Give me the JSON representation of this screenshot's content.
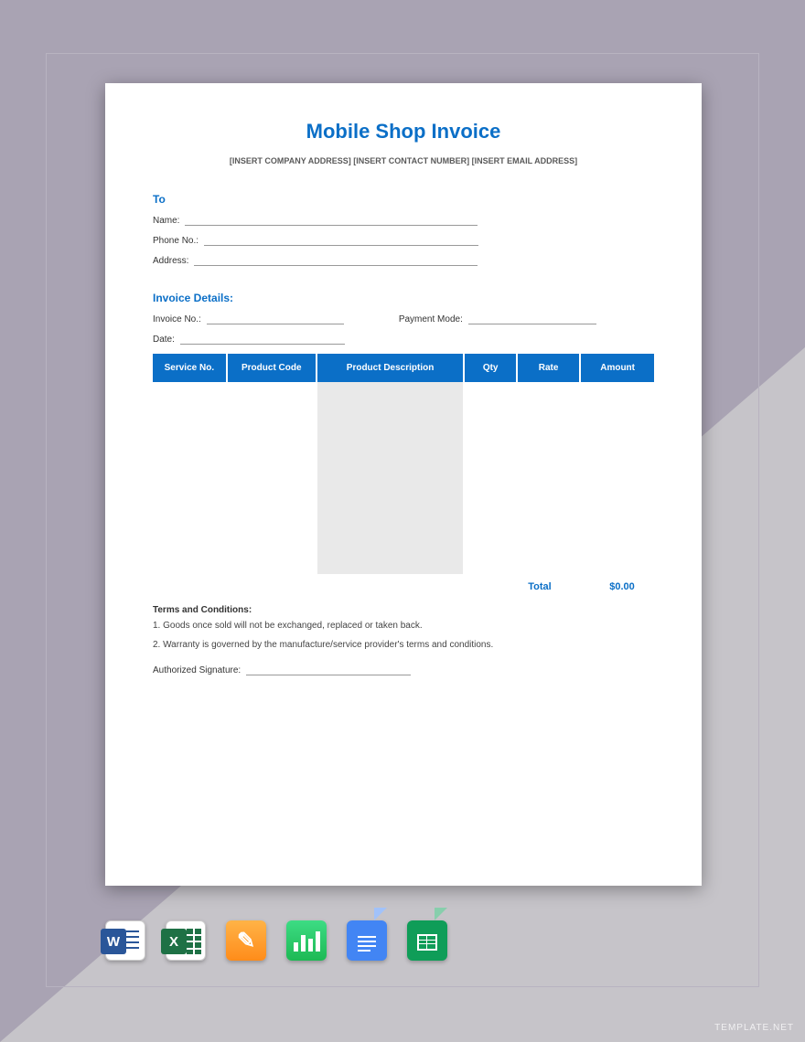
{
  "title": "Mobile Shop Invoice",
  "subtitle": "[INSERT COMPANY ADDRESS] [INSERT CONTACT NUMBER] [INSERT EMAIL ADDRESS]",
  "to": {
    "heading": "To",
    "name_label": "Name:",
    "phone_label": "Phone No.:",
    "address_label": "Address:"
  },
  "details": {
    "heading": "Invoice Details:",
    "invoice_no_label": "Invoice No.:",
    "date_label": "Date:",
    "payment_mode_label": "Payment Mode:"
  },
  "table": {
    "headers": {
      "service_no": "Service No.",
      "product_code": "Product Code",
      "product_description": "Product Description",
      "qty": "Qty",
      "rate": "Rate",
      "amount": "Amount"
    }
  },
  "totals": {
    "label": "Total",
    "value": "$0.00"
  },
  "terms": {
    "heading": "Terms and Conditions:",
    "t1": "1. Goods once sold will not be exchanged, replaced or taken back.",
    "t2": "2. Warranty is governed by the manufacture/service provider's terms and conditions."
  },
  "signature_label": "Authorized Signature:",
  "watermark": "TEMPLATE.NET",
  "icons": {
    "word": "W",
    "excel": "X",
    "pages": "✎",
    "numbers": "▲",
    "gdocs": "≡",
    "gsheets": "▦"
  }
}
